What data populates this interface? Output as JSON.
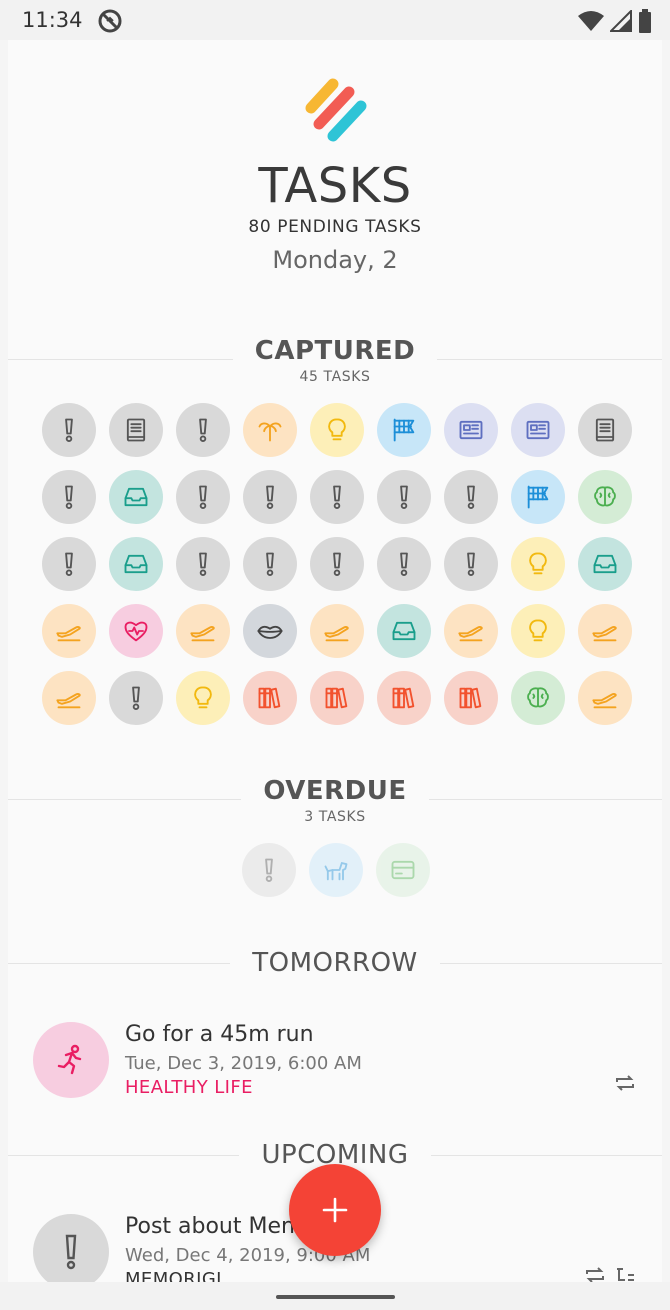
{
  "status_bar": {
    "time": "11:34"
  },
  "header": {
    "title": "TASKS",
    "pending": "80 PENDING TASKS",
    "date": "Monday, 2"
  },
  "colors": {
    "grey": "#d9d9d9",
    "grey_icon": "#555555",
    "orange": "#fde3c2",
    "orange_icon": "#f4a31f",
    "yellow": "#fdefb8",
    "yellow_icon": "#f2b90f",
    "blue": "#c7e6f8",
    "blue_icon": "#1d8fd8",
    "lavender": "#dcdff2",
    "lavender_icon": "#5e6fc0",
    "teal": "#c3e4df",
    "teal_icon": "#1a9e8c",
    "green": "#d4ecd5",
    "green_icon": "#4caf50",
    "pink": "#f7cde0",
    "pink_icon": "#e91e63",
    "red": "#f8d2c9",
    "red_icon": "#f2522e",
    "bluegrey": "#d3d7dc",
    "bluegrey_icon": "#444444",
    "accent_fab": "#f44336"
  },
  "captured": {
    "title": "CAPTURED",
    "count": "45 TASKS",
    "items": [
      {
        "icon": "exclamation-icon",
        "color": "grey"
      },
      {
        "icon": "book-icon",
        "color": "grey"
      },
      {
        "icon": "exclamation-icon",
        "color": "grey"
      },
      {
        "icon": "palm-tree-icon",
        "color": "orange"
      },
      {
        "icon": "lightbulb-icon",
        "color": "yellow"
      },
      {
        "icon": "checkered-flag-icon",
        "color": "blue"
      },
      {
        "icon": "newspaper-icon",
        "color": "lavender"
      },
      {
        "icon": "newspaper-icon",
        "color": "lavender"
      },
      {
        "icon": "book-icon",
        "color": "grey"
      },
      {
        "icon": "exclamation-icon",
        "color": "grey"
      },
      {
        "icon": "inbox-icon",
        "color": "teal"
      },
      {
        "icon": "exclamation-icon",
        "color": "grey"
      },
      {
        "icon": "exclamation-icon",
        "color": "grey"
      },
      {
        "icon": "exclamation-icon",
        "color": "grey"
      },
      {
        "icon": "exclamation-icon",
        "color": "grey"
      },
      {
        "icon": "exclamation-icon",
        "color": "grey"
      },
      {
        "icon": "checkered-flag-icon",
        "color": "blue"
      },
      {
        "icon": "brain-icon",
        "color": "green"
      },
      {
        "icon": "exclamation-icon",
        "color": "grey"
      },
      {
        "icon": "inbox-icon",
        "color": "teal"
      },
      {
        "icon": "exclamation-icon",
        "color": "grey"
      },
      {
        "icon": "exclamation-icon",
        "color": "grey"
      },
      {
        "icon": "exclamation-icon",
        "color": "grey"
      },
      {
        "icon": "exclamation-icon",
        "color": "grey"
      },
      {
        "icon": "exclamation-icon",
        "color": "grey"
      },
      {
        "icon": "lightbulb-icon",
        "color": "yellow"
      },
      {
        "icon": "inbox-icon",
        "color": "teal"
      },
      {
        "icon": "plane-icon",
        "color": "orange"
      },
      {
        "icon": "heartbeat-icon",
        "color": "pink"
      },
      {
        "icon": "plane-icon",
        "color": "orange"
      },
      {
        "icon": "lips-icon",
        "color": "bluegrey"
      },
      {
        "icon": "plane-icon",
        "color": "orange"
      },
      {
        "icon": "inbox-icon",
        "color": "teal"
      },
      {
        "icon": "plane-icon",
        "color": "orange"
      },
      {
        "icon": "lightbulb-icon",
        "color": "yellow"
      },
      {
        "icon": "plane-icon",
        "color": "orange"
      },
      {
        "icon": "plane-icon",
        "color": "orange"
      },
      {
        "icon": "exclamation-icon",
        "color": "grey"
      },
      {
        "icon": "lightbulb-icon",
        "color": "yellow"
      },
      {
        "icon": "books-icon",
        "color": "red"
      },
      {
        "icon": "books-icon",
        "color": "red"
      },
      {
        "icon": "books-icon",
        "color": "red"
      },
      {
        "icon": "books-icon",
        "color": "red"
      },
      {
        "icon": "brain-icon",
        "color": "green"
      },
      {
        "icon": "plane-icon",
        "color": "orange"
      }
    ]
  },
  "overdue": {
    "title": "OVERDUE",
    "count": "3 TASKS",
    "items": [
      {
        "icon": "exclamation-icon",
        "color": "grey"
      },
      {
        "icon": "dog-icon",
        "color": "blue"
      },
      {
        "icon": "credit-card-icon",
        "color": "green"
      }
    ]
  },
  "tomorrow": {
    "title": "TOMORROW",
    "task": {
      "title": "Go for a 45m run",
      "date": "Tue, Dec 3, 2019, 6:00 AM",
      "category": "HEALTHY LIFE",
      "category_color": "#e91e63",
      "icon": "running-icon",
      "repeat": true
    }
  },
  "upcoming": {
    "title": "UPCOMING",
    "task": {
      "title": "Post about Men",
      "date": "Wed, Dec 4, 2019, 9:00 AM",
      "category": "MEMORIGI",
      "category_color": "#333333",
      "icon": "exclamation-icon",
      "repeat": true,
      "subtasks": true
    }
  }
}
